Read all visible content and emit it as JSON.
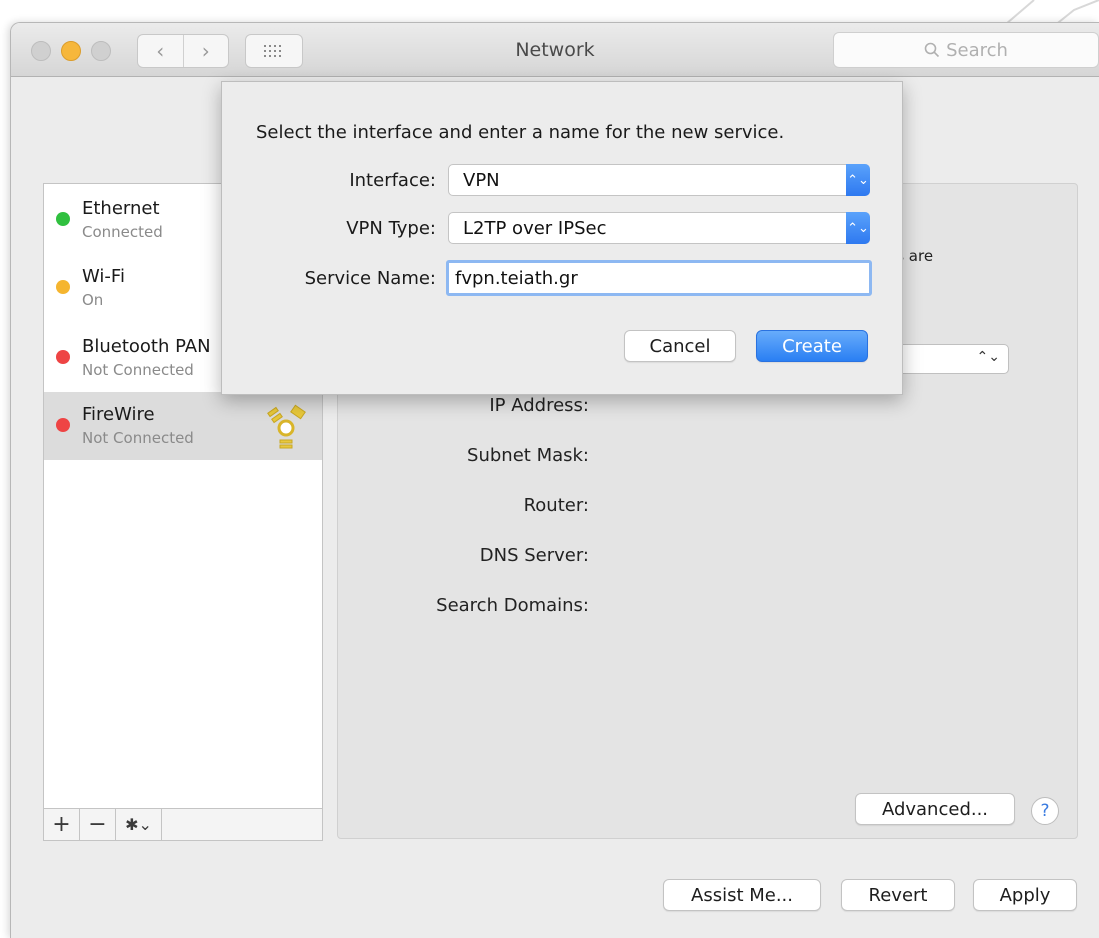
{
  "window": {
    "title": "Network",
    "search_placeholder": "Search",
    "nav_back": "‹",
    "nav_forward": "›"
  },
  "services": [
    {
      "name": "Ethernet",
      "status": "Connected",
      "color": "#30c03f"
    },
    {
      "name": "Wi-Fi",
      "status": "On",
      "color": "#f5b52f"
    },
    {
      "name": "Bluetooth PAN",
      "status": "Not Connected",
      "color": "#ee4444"
    },
    {
      "name": "FireWire",
      "status": "Not Connected",
      "color": "#ee4444"
    }
  ],
  "sidebar_tools": {
    "add": "+",
    "remove": "−",
    "gear": "✱⌄"
  },
  "main": {
    "partial_text": "es are",
    "fields": [
      "IP Address:",
      "Subnet Mask:",
      "Router:",
      "DNS Server:",
      "Search Domains:"
    ],
    "advanced_label": "Advanced...",
    "help_label": "?"
  },
  "footer": {
    "assist": "Assist Me...",
    "revert": "Revert",
    "apply": "Apply"
  },
  "dialog": {
    "prompt": "Select the interface and enter a name for the new service.",
    "interface_label": "Interface:",
    "interface_value": "VPN",
    "vpn_type_label": "VPN Type:",
    "vpn_type_value": "L2TP over IPSec",
    "service_name_label": "Service Name:",
    "service_name_value": "fvpn.teiath.gr",
    "cancel_label": "Cancel",
    "create_label": "Create"
  }
}
